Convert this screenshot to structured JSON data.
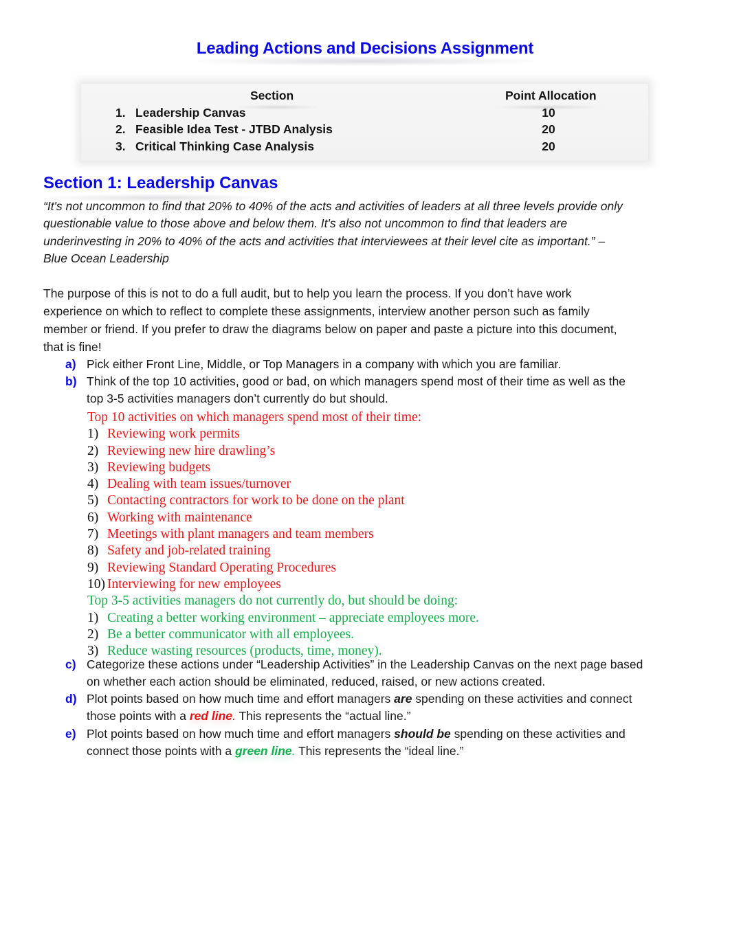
{
  "document": {
    "title": "Leading Actions and Decisions Assignment",
    "points_table": {
      "headers": {
        "section": "Section",
        "points": "Point Allocation"
      },
      "rows": [
        {
          "num": "1.",
          "section": "Leadership Canvas",
          "points": "10"
        },
        {
          "num": "2.",
          "section": "Feasible Idea Test - JTBD Analysis",
          "points": "20"
        },
        {
          "num": "3.",
          "section": "Critical Thinking Case Analysis",
          "points": "20"
        }
      ]
    },
    "section1": {
      "heading": "Section 1: Leadership Canvas",
      "quote_lines": [
        " “It's not uncommon to find that 20% to 40% of the acts and activities of leaders at all three levels provide only",
        "questionable value to those above and below them. It's also not uncommon to find that leaders are",
        "underinvesting in 20% to 40% of the acts and activities that interviewees at their level cite as important.” –",
        "Blue Ocean Leadership"
      ],
      "intro_lines": [
        "The purpose of this is not to do a full audit, but to help you learn the process. If you don’t have work",
        "experience on which to reflect to complete these assignments, interview another person such as family",
        "member or friend. If you prefer to draw the diagrams below on paper and paste a picture into this document,",
        "that is fine!"
      ],
      "items": {
        "a": {
          "label": "a)",
          "lines": [
            "Pick either Front Line, Middle, or Top Managers in a company with which you are familiar."
          ]
        },
        "b": {
          "label": "b)",
          "lines": [
            "Think of the top 10 activities, good or bad, on which managers spend most of their time as well as the",
            "top 3-5 activities managers don’t currently do but should."
          ]
        },
        "c": {
          "label": "c)",
          "lines": [
            "Categorize these actions under “Leadership Activities” in the Leadership Canvas on the next page based",
            "on whether each action should be eliminated, reduced, raised, or new actions created."
          ]
        },
        "d": {
          "label": "d)",
          "line1_pre": "Plot points based on how much time and effort managers ",
          "line1_emph": "are",
          "line1_post": " spending on these activities and connect",
          "line2_pre": "those points with a ",
          "line2_emph": "red line",
          "line2_punct": ".",
          "line2_post": " This represents the “actual line.”"
        },
        "e": {
          "label": "e)",
          "line1_pre": "Plot points based on how much time and effort managers ",
          "line1_emph": "should be",
          "line1_post": " spending on these activities and",
          "line2_pre": "connect those points with a ",
          "line2_emph": "green line",
          "line2_punct": ".",
          "line2_post": " This represents the “ideal line.”"
        }
      },
      "answers": {
        "top10_heading": "Top 10 activities on which managers spend most of their time:",
        "top10": [
          {
            "num": "1)",
            "text": "Reviewing work permits"
          },
          {
            "num": "2)",
            "text": "Reviewing new hire drawling’s"
          },
          {
            "num": "3)",
            "text": "Reviewing budgets"
          },
          {
            "num": "4)",
            "text": "Dealing with team issues/turnover"
          },
          {
            "num": "5)",
            "text": "Contacting contractors for work to be done on the plant"
          },
          {
            "num": "6)",
            "text": "Working with maintenance"
          },
          {
            "num": "7)",
            "text": "Meetings with plant managers and team members"
          },
          {
            "num": "8)",
            "text": "Safety and job-related training"
          },
          {
            "num": "9)",
            "text": "Reviewing Standard Operating Procedures"
          },
          {
            "num": "10)",
            "text": "Interviewing for new employees"
          }
        ],
        "should_heading": "Top 3-5 activities managers do not currently do, but should be doing:",
        "should": [
          {
            "num": "1)",
            "text": "Creating a better working environment – appreciate employees more."
          },
          {
            "num": "2)",
            "text": "Be a better communicator with all employees."
          },
          {
            "num": "3)",
            "text": "Reduce wasting resources (products, time, money)."
          }
        ]
      }
    },
    "colors": {
      "heading_blue": "#0a0ae6",
      "answer_red": "#f01414",
      "answer_green": "#13b04a"
    }
  }
}
